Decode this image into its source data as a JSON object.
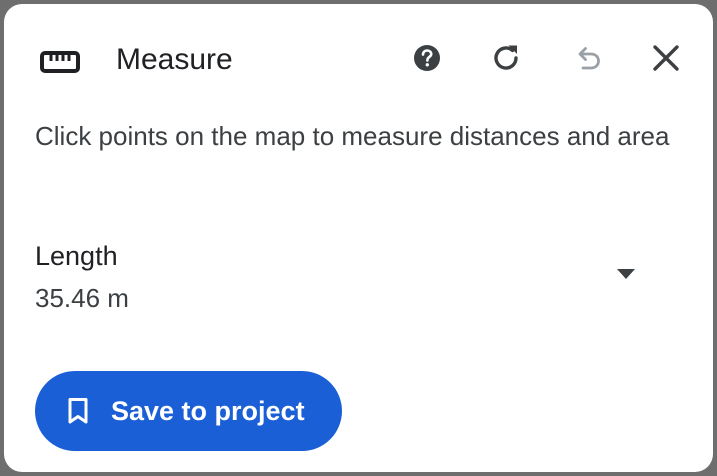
{
  "header": {
    "icon": "ruler-icon",
    "title": "Measure",
    "actions": [
      {
        "icon": "help-icon"
      },
      {
        "icon": "refresh-icon"
      },
      {
        "icon": "undo-icon",
        "state": "disabled"
      },
      {
        "icon": "close-icon"
      }
    ]
  },
  "description": "Click points on the map to measure distances and area",
  "measurement": {
    "label": "Length",
    "value": "35.46 m",
    "dropdown_icon": "caret-down-icon"
  },
  "save_button": {
    "icon": "bookmark-icon",
    "label": "Save to project"
  },
  "colors": {
    "primary": "#1a5fd6",
    "text": "#202124",
    "icon_dark": "#3c4043",
    "icon_disabled": "#9aa0a6"
  }
}
